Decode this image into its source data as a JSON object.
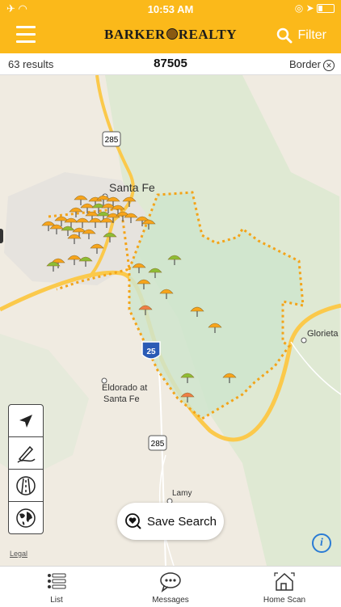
{
  "status": {
    "time": "10:53 AM"
  },
  "header": {
    "brand_left": "BARKER",
    "brand_right": "REALTY",
    "filter_label": "Filter"
  },
  "subbar": {
    "results": "63 results",
    "zip": "87505",
    "border_label": "Border"
  },
  "map": {
    "labels": {
      "city": "Santa Fe",
      "eldorado_1": "Eldorado at",
      "eldorado_2": "Santa Fe",
      "lamy": "Lamy",
      "glorieta": "Glorieta",
      "hwy285_top": "285",
      "hwy285_bottom": "285",
      "interstate": "25"
    },
    "legal": "Legal",
    "colors": {
      "pin_orange": "#f7a41b",
      "pin_green": "#8dbd34",
      "pin_red": "#ee7d45",
      "boundary": "#f3a41a",
      "polygon_fill": "#d4e8d2"
    }
  },
  "tools": {
    "icons": [
      "locate-arrow-icon",
      "draw-pencil-icon",
      "road-icon",
      "globe-icon"
    ]
  },
  "save_search": {
    "label": "Save Search"
  },
  "tabs": [
    {
      "label": "List",
      "icon": "list-icon"
    },
    {
      "label": "Messages",
      "icon": "chat-bubble-icon"
    },
    {
      "label": "Home Scan",
      "icon": "house-scan-icon"
    }
  ]
}
